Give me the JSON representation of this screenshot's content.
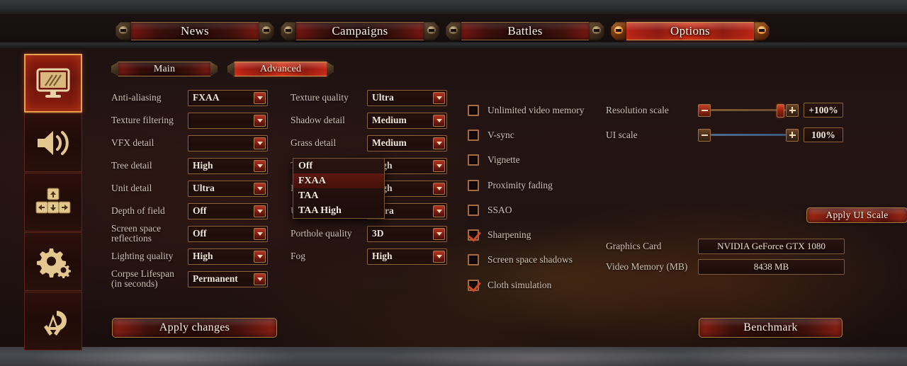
{
  "nav": {
    "tabs": [
      {
        "label": "News",
        "active": false
      },
      {
        "label": "Campaigns",
        "active": false
      },
      {
        "label": "Battles",
        "active": false
      },
      {
        "label": "Options",
        "active": true
      }
    ]
  },
  "sidebar": {
    "items": [
      {
        "name": "graphics",
        "icon": "monitor-icon",
        "active": true
      },
      {
        "name": "audio",
        "icon": "speaker-icon",
        "active": false
      },
      {
        "name": "controls",
        "icon": "arrow-keys-icon",
        "active": false
      },
      {
        "name": "gameplay",
        "icon": "gears-icon",
        "active": false
      },
      {
        "name": "account",
        "icon": "emblem-icon",
        "active": false
      }
    ]
  },
  "sub_tabs": [
    {
      "label": "Main",
      "active": false
    },
    {
      "label": "Advanced",
      "active": true
    }
  ],
  "left_column": [
    {
      "label": "Anti-aliasing",
      "value": "FXAA"
    },
    {
      "label": "Texture filtering",
      "value": ""
    },
    {
      "label": "VFX detail",
      "value": ""
    },
    {
      "label": "Tree detail",
      "value": "High"
    },
    {
      "label": "Unit detail",
      "value": "Ultra"
    },
    {
      "label": "Depth of field",
      "value": "Off"
    },
    {
      "label": "Screen space\nreflections",
      "value": "Off"
    },
    {
      "label": "Lighting quality",
      "value": "High"
    },
    {
      "label": "Corpse Lifespan\n(in seconds)",
      "value": "Permanent"
    }
  ],
  "mid_column": [
    {
      "label": "Texture quality",
      "value": "Ultra"
    },
    {
      "label": "Shadow detail",
      "value": "Medium"
    },
    {
      "label": "Grass detail",
      "value": "Medium"
    },
    {
      "label": "Terrain detail",
      "value": "High"
    },
    {
      "label": "Building detail",
      "value": "High"
    },
    {
      "label": "Unit size",
      "value": "Ultra"
    },
    {
      "label": "Porthole quality",
      "value": "3D"
    },
    {
      "label": "Fog",
      "value": "High"
    }
  ],
  "open_dropdown": {
    "for": "Anti-aliasing",
    "options": [
      "Off",
      "FXAA",
      "TAA",
      "TAA High"
    ],
    "selected": "FXAA"
  },
  "checkboxes": [
    {
      "label": "Unlimited video memory",
      "checked": false
    },
    {
      "label": "V-sync",
      "checked": false
    },
    {
      "label": "Vignette",
      "checked": false
    },
    {
      "label": "Proximity fading",
      "checked": false
    },
    {
      "label": "SSAO",
      "checked": false
    },
    {
      "label": "Sharpening",
      "checked": true
    },
    {
      "label": "Screen space shadows",
      "checked": false
    },
    {
      "label": "Cloth simulation",
      "checked": true
    }
  ],
  "sliders": [
    {
      "label": "Resolution scale",
      "readout": "+100%",
      "fill_pct": 88,
      "accent": "red"
    },
    {
      "label": "UI scale",
      "readout": "100%",
      "fill_pct": 100,
      "accent": "blue"
    }
  ],
  "apply_ui_scale_label": "Apply UI Scale",
  "info": [
    {
      "label": "Graphics Card",
      "value": "NVIDIA GeForce GTX 1080"
    },
    {
      "label": "Video Memory (MB)",
      "value": "8438 MB"
    }
  ],
  "actions": {
    "apply_changes": "Apply changes",
    "benchmark": "Benchmark"
  },
  "colors": {
    "accent_red": "#b32a18",
    "gold_border": "#a77a43",
    "text_primary": "#f5ebdc",
    "text_label": "#cfc2b4",
    "check_mark": "#d24a22"
  }
}
